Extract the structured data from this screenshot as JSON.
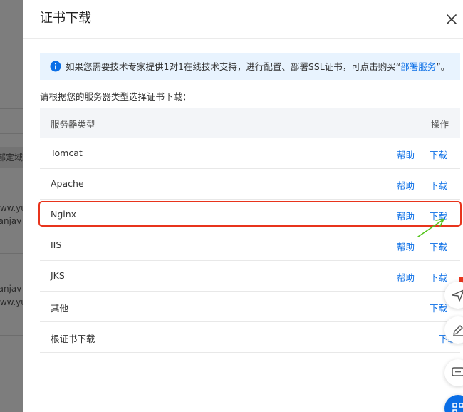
{
  "background": {
    "texts": [
      "部定域名",
      "www.yu",
      "uanjav",
      "uanjav",
      "www.yu"
    ]
  },
  "drawer": {
    "title": "证书下载",
    "notice": {
      "text_before": "如果您需要技术专家提供1对1在线技术支持，进行配置、部署SSL证书，可点击购买“",
      "link": "部署服务",
      "text_after": "”。"
    },
    "hint": "请根据您的服务器类型选择证书下载："
  },
  "table": {
    "columns": {
      "type": "服务器类型",
      "operation": "操作"
    },
    "help_label": "帮助",
    "download_label": "下载",
    "rows": [
      {
        "name": "Tomcat",
        "has_help": true
      },
      {
        "name": "Apache",
        "has_help": true
      },
      {
        "name": "Nginx",
        "has_help": true
      },
      {
        "name": "IIS",
        "has_help": true
      },
      {
        "name": "JKS",
        "has_help": true
      },
      {
        "name": "其他",
        "has_help": false
      },
      {
        "name": "根证书下载",
        "has_help": false
      }
    ]
  },
  "colors": {
    "link": "#0a6ee6",
    "highlight": "#e8341c",
    "arrow": "#52c41a",
    "notice_bg": "#e8f3fe"
  },
  "icons": {
    "notice": "info-circle-icon",
    "close": "close-icon",
    "float1": "paper-plane-icon",
    "float2": "edit-icon",
    "float3": "chat-icon",
    "float4": "grid-icon"
  }
}
